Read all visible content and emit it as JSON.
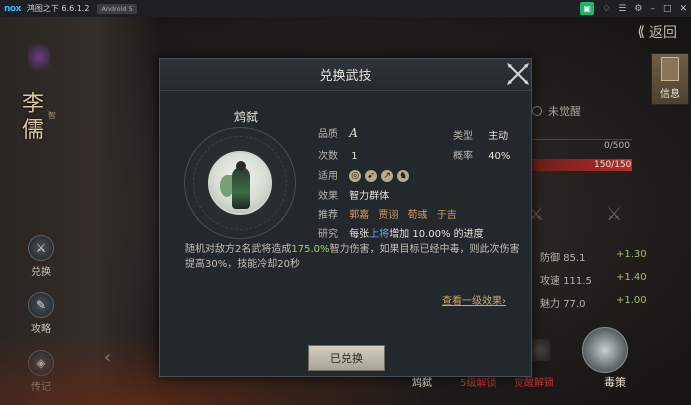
{
  "emulator": {
    "logo": "nox",
    "title": "鸿图之下 6.6.1.2",
    "android_badge": "Android 5",
    "controls": [
      "multi-instance-icon",
      "notification-icon",
      "menu-icon",
      "settings-icon",
      "minimize-icon",
      "maximize-icon",
      "close-icon"
    ]
  },
  "game": {
    "back_label": "返回",
    "info_label": "信息",
    "general_name": "李儒",
    "general_tag": "智",
    "left_buttons": [
      "兑换",
      "攻略",
      "传记"
    ],
    "unawakened": "未觉醒",
    "bar1_text": "0/500",
    "bar2_text": "150/150",
    "stats": [
      {
        "label": "防御",
        "value": "85.1",
        "plus": "+1.30"
      },
      {
        "label": "攻速",
        "value": "111.5",
        "plus": "+1.40"
      },
      {
        "label": "魅力",
        "value": "77.0",
        "plus": "+1.00"
      }
    ],
    "bottom_tags": {
      "wuxi": "鸩弑",
      "lvl5": "5级解锁",
      "full_awake": "觉醒解锁",
      "dulce": "毒策"
    }
  },
  "modal": {
    "title": "兑换武技",
    "skill_name": "鸩弑",
    "quality_label": "品质",
    "quality_value": "A",
    "type_label": "类型",
    "type_value": "主动",
    "count_label": "次数",
    "count_value": "1",
    "rate_label": "概率",
    "rate_value": "40%",
    "usable_label": "适用",
    "effect_label": "效果",
    "effect_value": "智力群体",
    "recommend_label": "推荐",
    "recommend_values": [
      "郭嘉",
      "贾诩",
      "荀彧",
      "于吉"
    ],
    "research_label": "研究",
    "research_prefix": "每张",
    "research_highlight": "上将",
    "research_suffix": "增加 10.00% 的进度",
    "desc_part1": "随机对敌方2名武将造成",
    "desc_highlight": "175.0%",
    "desc_part2": "智力伤害，如果目标已经中毒，则此次伤害提高30%，技能冷却20秒",
    "detail_link": "查看一级效果",
    "redeem_button": "已兑换"
  }
}
